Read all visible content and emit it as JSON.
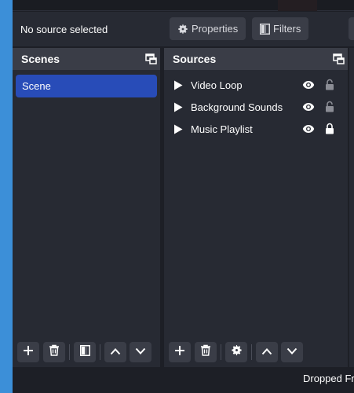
{
  "context_bar": {
    "source_status": "No source selected",
    "properties_label": "Properties",
    "filters_label": "Filters"
  },
  "scenes_dock": {
    "title": "Scenes",
    "items": [
      {
        "label": "Scene",
        "selected": true
      }
    ],
    "toolbar": [
      "add-icon",
      "trash-icon",
      "filter-icon",
      "chevron-up-icon",
      "chevron-down-icon"
    ]
  },
  "sources_dock": {
    "title": "Sources",
    "items": [
      {
        "label": "Video Loop",
        "visible": true,
        "locked": false
      },
      {
        "label": "Background Sounds",
        "visible": true,
        "locked": false
      },
      {
        "label": "Music Playlist",
        "visible": true,
        "locked": true
      }
    ],
    "toolbar": [
      "add-icon",
      "trash-icon",
      "gear-icon",
      "chevron-up-icon",
      "chevron-down-icon"
    ]
  },
  "status_bar": {
    "dropped_frames_text": "Dropped Fr"
  },
  "colors": {
    "selection": "#284cb8",
    "dock_bg": "#272a33",
    "header_bg": "#3a3d47",
    "window_bg": "#1d1f26",
    "desktop": "#3c8fd8"
  }
}
